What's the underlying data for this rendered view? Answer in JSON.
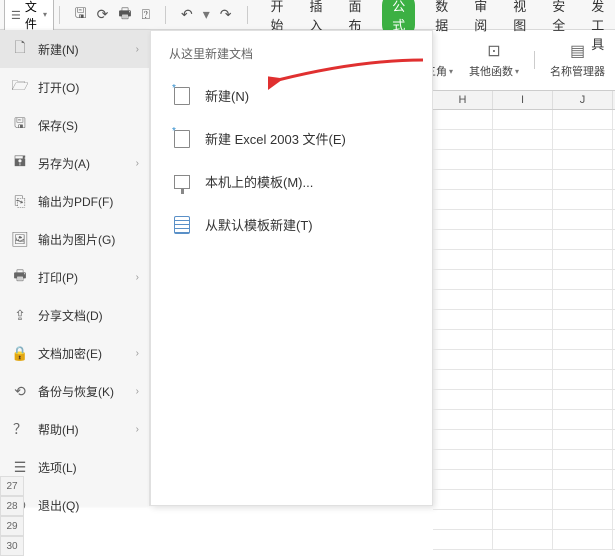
{
  "toolbar": {
    "file_label": "文件"
  },
  "tabs": {
    "start": "开始",
    "insert": "插入",
    "page_layout": "页面布局",
    "formula": "公式",
    "data": "数据",
    "review": "审阅",
    "view": "视图",
    "security": "安全",
    "dev_tools": "开发工具"
  },
  "ribbon": {
    "math_trig": "数学和三角",
    "other_func": "其他函数",
    "name_manager": "名称管理器"
  },
  "file_menu": {
    "items": [
      {
        "label": "新建(N)",
        "has_chevron": true
      },
      {
        "label": "打开(O)",
        "has_chevron": false
      },
      {
        "label": "保存(S)",
        "has_chevron": false
      },
      {
        "label": "另存为(A)",
        "has_chevron": true
      },
      {
        "label": "输出为PDF(F)",
        "has_chevron": false
      },
      {
        "label": "输出为图片(G)",
        "has_chevron": false
      },
      {
        "label": "打印(P)",
        "has_chevron": true
      },
      {
        "label": "分享文档(D)",
        "has_chevron": false
      },
      {
        "label": "文档加密(E)",
        "has_chevron": true
      },
      {
        "label": "备份与恢复(K)",
        "has_chevron": true
      },
      {
        "label": "帮助(H)",
        "has_chevron": true
      },
      {
        "label": "选项(L)",
        "has_chevron": false
      },
      {
        "label": "退出(Q)",
        "has_chevron": false
      }
    ]
  },
  "submenu": {
    "header": "从这里新建文档",
    "items": [
      {
        "label": "新建(N)"
      },
      {
        "label": "新建 Excel 2003 文件(E)"
      },
      {
        "label": "本机上的模板(M)..."
      },
      {
        "label": "从默认模板新建(T)"
      }
    ]
  },
  "sheet": {
    "columns": [
      "H",
      "I",
      "J"
    ],
    "row_numbers": [
      "27",
      "28",
      "29",
      "30"
    ]
  },
  "colors": {
    "accent_green": "#3cb043",
    "arrow_red": "#e03030"
  }
}
